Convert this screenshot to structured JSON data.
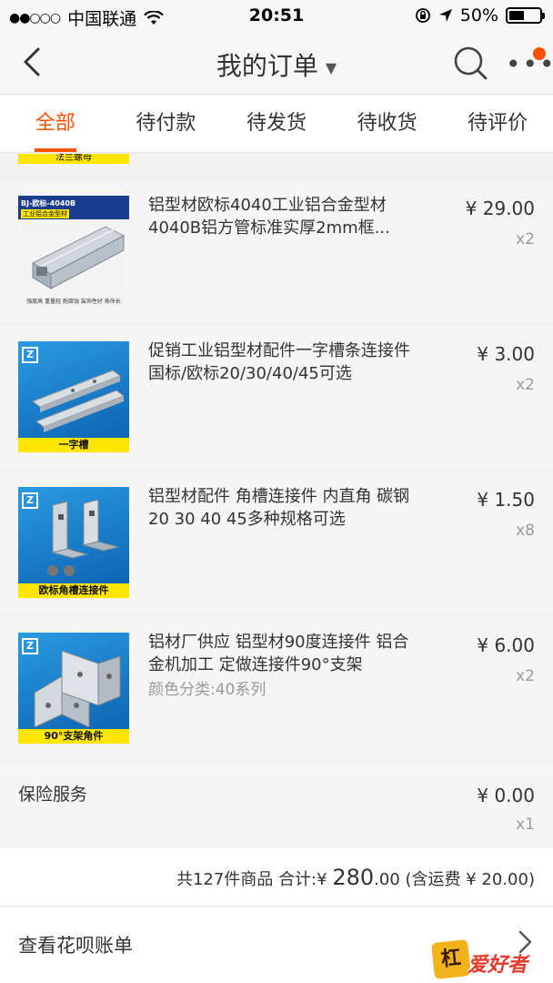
{
  "status_bar": {
    "carrier": "中国联通",
    "time": "20:51",
    "battery": "50%",
    "battery_level": 0.5
  },
  "nav": {
    "title": "我的订单"
  },
  "tabs": [
    {
      "label": "全部",
      "active": true
    },
    {
      "label": "待付款",
      "active": false
    },
    {
      "label": "待发货",
      "active": false
    },
    {
      "label": "待收货",
      "active": false
    },
    {
      "label": "待评价",
      "active": false
    }
  ],
  "cutoff_item": {
    "caption": "法兰螺母"
  },
  "items": [
    {
      "title": "铝型材欧标4040工业铝合金型材4040B铝方管标准实厚2mm框...",
      "price": "¥ 29.00",
      "qty": "x2",
      "variant": "",
      "thumb_label": "BJ-欧标-4040B",
      "thumb_sub": "工业铝合金型材",
      "thumb_footer": "强度高  重量轻  耐腐蚀  装饰性好  寿命长"
    },
    {
      "title": "促销工业铝型材配件一字槽条连接件 国标/欧标20/30/40/45可选",
      "price": "¥ 3.00",
      "qty": "x2",
      "variant": "",
      "thumb_caption": "一字槽"
    },
    {
      "title": "铝型材配件 角槽连接件 内直角 碳钢 20 30 40 45多种规格可选",
      "price": "¥ 1.50",
      "qty": "x8",
      "variant": "",
      "thumb_caption": "欧标角槽连接件"
    },
    {
      "title": "铝材厂供应 铝型材90度连接件 铝合金机加工 定做连接件90°支架",
      "price": "¥ 6.00",
      "qty": "x2",
      "variant": "颜色分类:40系列",
      "thumb_caption": "90°支架角件"
    }
  ],
  "insurance": {
    "label": "保险服务",
    "price": "¥ 0.00",
    "qty": "x1"
  },
  "summary": {
    "count_text": "共127件商品",
    "total_label": "合计:",
    "currency": "¥",
    "total_int": "280",
    "total_dec": ".00",
    "shipping": "(含运费 ¥ 20.00)"
  },
  "huabei": {
    "label": "查看花呗账单"
  },
  "watermark": {
    "text": "爱好者"
  }
}
